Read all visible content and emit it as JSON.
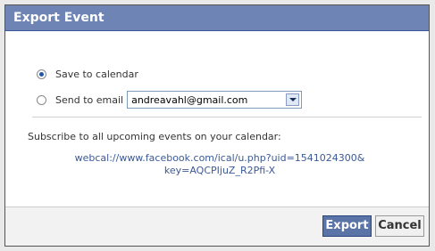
{
  "dialog": {
    "title": "Export Event",
    "save_option": {
      "label": "Save to calendar",
      "selected": true
    },
    "email_option": {
      "label": "Send to email",
      "selected": false,
      "email_value": "andreavahl@gmail.com"
    },
    "subscribe_text": "Subscribe to all upcoming events on your calendar:",
    "subscribe_link_line1": "webcal://www.facebook.com/ical/u.php?uid=1541024300&",
    "subscribe_link_line2": "key=AQCPIjuZ_R2Pfi-X",
    "buttons": {
      "export_label": "Export",
      "cancel_label": "Cancel"
    },
    "colors": {
      "header": "#6d84b4",
      "link": "#3b5998",
      "primary_button": "#5b74a8"
    }
  }
}
